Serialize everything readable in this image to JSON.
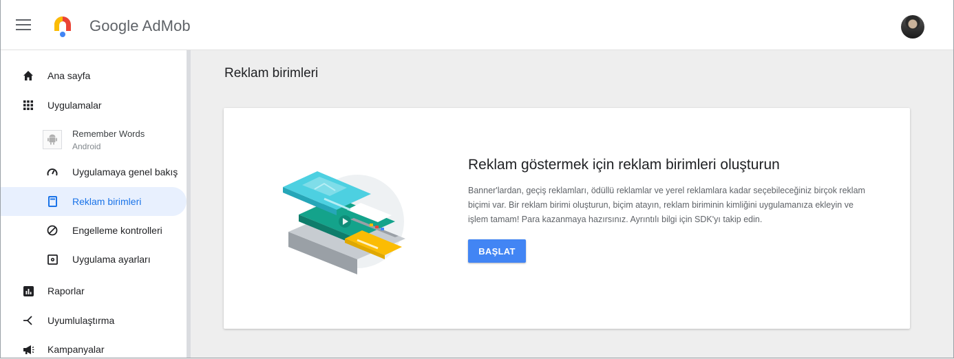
{
  "header": {
    "brand": "Google AdMob",
    "menu_icon": "hamburger-menu-icon",
    "logo_icon": "admob-logo-icon",
    "avatar_icon": "user-avatar-icon"
  },
  "sidebar": {
    "items": [
      {
        "label": "Ana sayfa",
        "icon": "home-icon"
      },
      {
        "label": "Uygulamalar",
        "icon": "apps-grid-icon"
      },
      {
        "label": "Uygulamaya genel bakış",
        "icon": "speedometer-icon"
      },
      {
        "label": "Reklam birimleri",
        "icon": "ad-unit-icon"
      },
      {
        "label": "Engelleme kontrolleri",
        "icon": "block-icon"
      },
      {
        "label": "Uygulama ayarları",
        "icon": "settings-box-icon"
      },
      {
        "label": "Raporlar",
        "icon": "reports-icon"
      },
      {
        "label": "Uyumlulaştırma",
        "icon": "mediation-icon"
      },
      {
        "label": "Kampanyalar",
        "icon": "megaphone-icon"
      }
    ],
    "app": {
      "name": "Remember Words",
      "platform": "Android",
      "icon": "android-icon"
    },
    "active_color": "#1a73e8"
  },
  "main": {
    "title": "Reklam birimleri",
    "card": {
      "heading": "Reklam göstermek için reklam birimleri oluşturun",
      "body": "Banner'lardan, geçiş reklamları, ödüllü reklamlar ve yerel reklamlara kadar seçebileceğiniz birçok reklam biçimi var. Bir reklam birimi oluşturun, biçim atayın, reklam biriminin kimliğini uygulamanıza ekleyin ve işlem tamam! Para kazanmaya hazırsınız. Ayrıntılı bilgi için SDK'yı takip edin.",
      "button": "BAŞLAT",
      "button_color": "#4285f4",
      "illustration": "ad-formats-illustration"
    }
  }
}
